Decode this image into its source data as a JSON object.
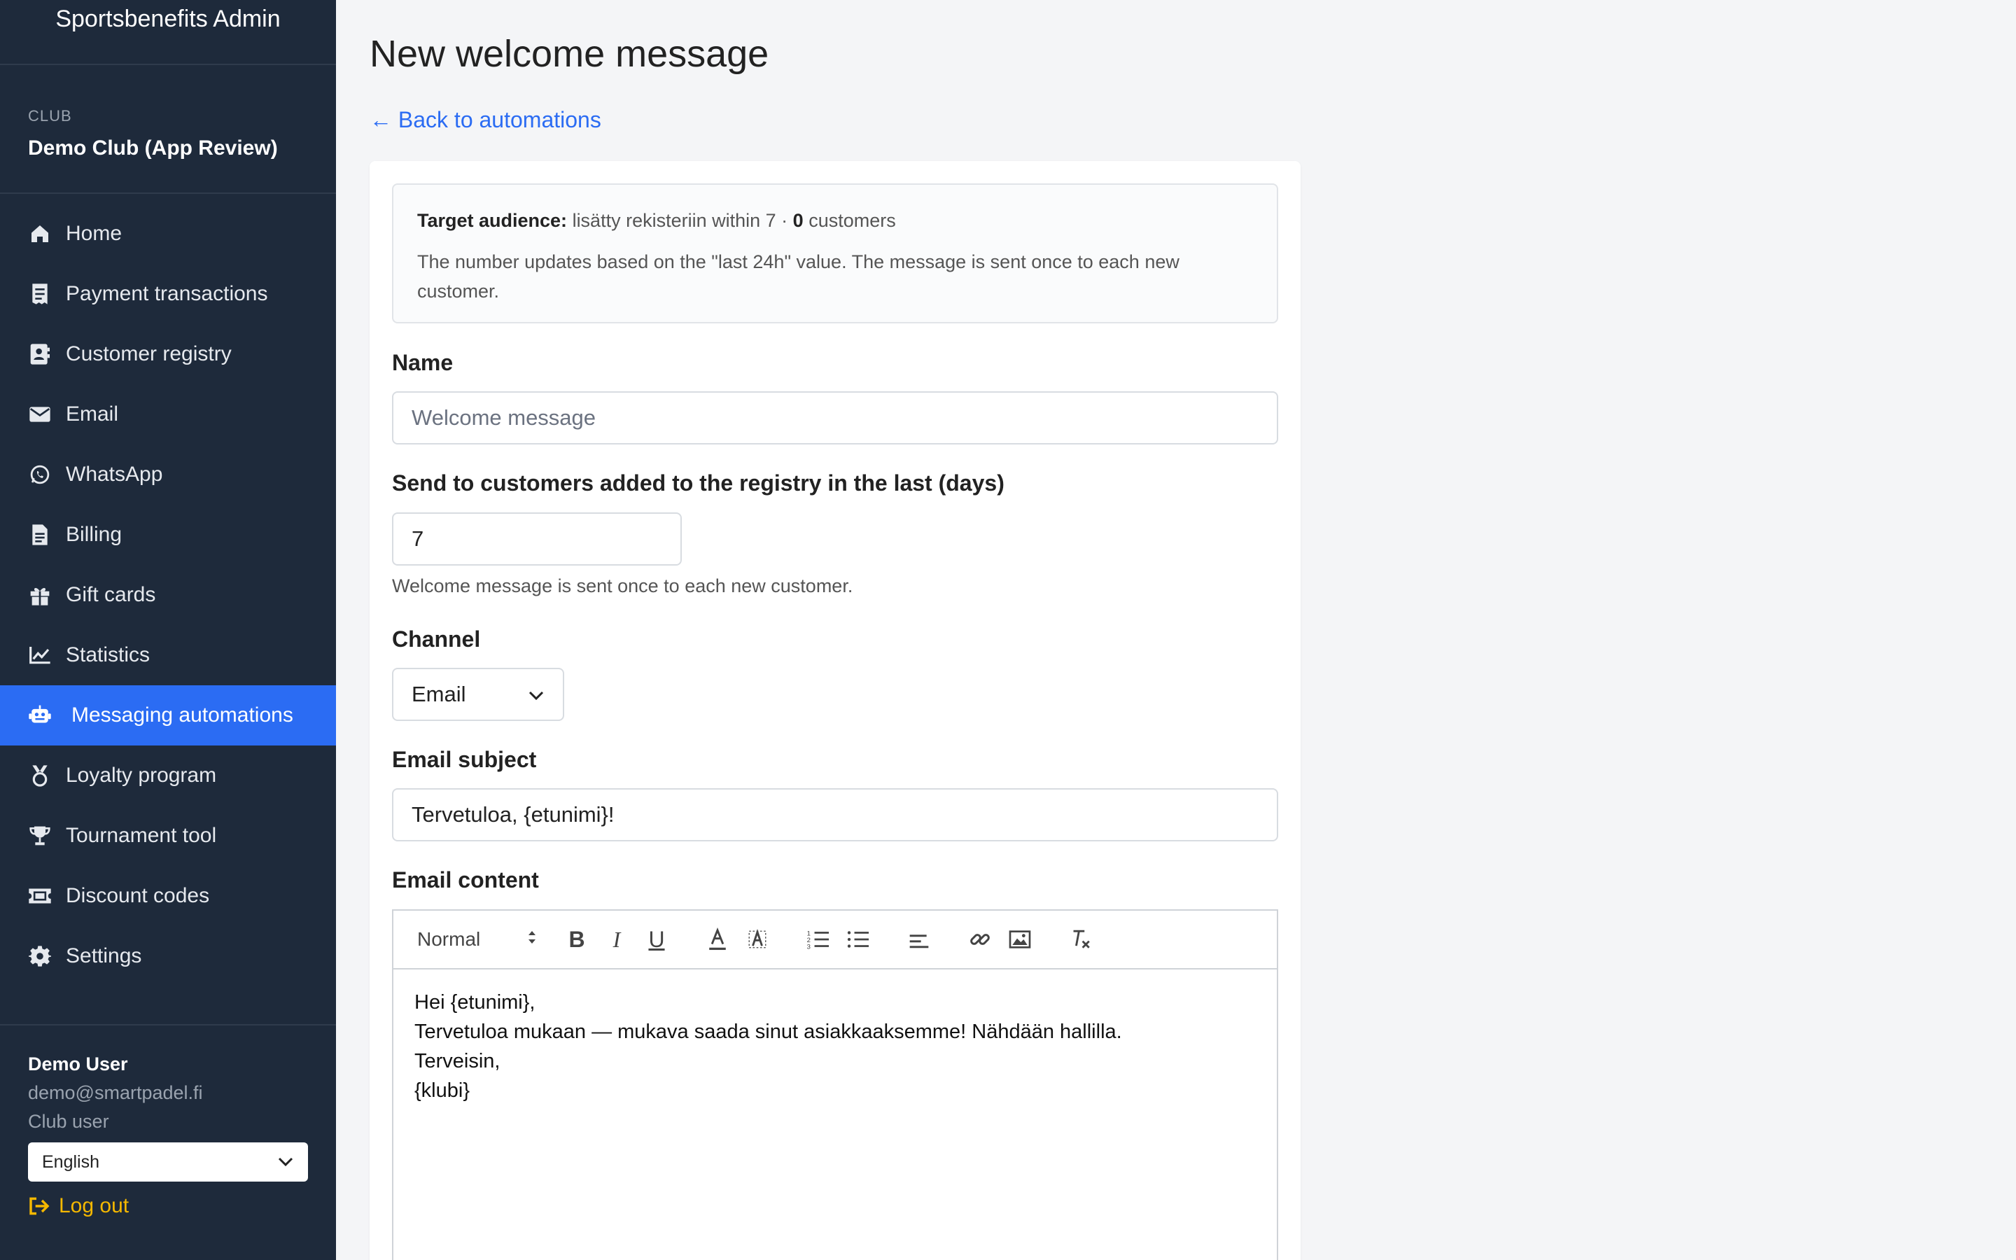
{
  "app": {
    "title": "Sportsbenefits Admin"
  },
  "club": {
    "caption": "CLUB",
    "name": "Demo Club (App Review)"
  },
  "nav": {
    "items": [
      {
        "label": "Home",
        "icon": "home-icon"
      },
      {
        "label": "Payment transactions",
        "icon": "receipt-icon"
      },
      {
        "label": "Customer registry",
        "icon": "contact-card-icon"
      },
      {
        "label": "Email",
        "icon": "envelope-icon"
      },
      {
        "label": "WhatsApp",
        "icon": "whatsapp-icon"
      },
      {
        "label": "Billing",
        "icon": "invoice-icon"
      },
      {
        "label": "Gift cards",
        "icon": "gift-icon"
      },
      {
        "label": "Statistics",
        "icon": "chart-line-icon"
      },
      {
        "label": "Messaging automations",
        "icon": "robot-icon",
        "active": true
      },
      {
        "label": "Loyalty program",
        "icon": "medal-icon"
      },
      {
        "label": "Tournament tool",
        "icon": "trophy-icon"
      },
      {
        "label": "Discount codes",
        "icon": "ticket-icon"
      },
      {
        "label": "Settings",
        "icon": "gear-icon"
      }
    ]
  },
  "user": {
    "name": "Demo User",
    "email": "demo@smartpadel.fi",
    "role": "Club user",
    "language": "English",
    "logout_label": "Log out"
  },
  "page": {
    "title": "New welcome message",
    "back_link": "← Back to automations"
  },
  "audience": {
    "label": "Target audience:",
    "text": " lisätty rekisteriin within 7 · ",
    "count": "0",
    "unit": " customers",
    "note": "The number updates based on the \"last 24h\" value. The message is sent once to each new customer."
  },
  "form": {
    "name_label": "Name",
    "name_placeholder": "Welcome message",
    "days_label": "Send to customers added to the registry in the last (days)",
    "days_value": "7",
    "days_help": "Welcome message is sent once to each new customer.",
    "channel_label": "Channel",
    "channel_value": "Email",
    "subject_label": "Email subject",
    "subject_value": "Tervetuloa, {etunimi}!",
    "content_label": "Email content",
    "editor_style": "Normal",
    "content_lines": [
      "Hei {etunimi},",
      "Tervetuloa mukaan — mukava saada sinut asiakkaaksemme! Nähdään hallilla.",
      "Terveisin,",
      "{klubi}"
    ]
  },
  "colors": {
    "sidebar_bg": "#1e2a3b",
    "active_bg": "#2b6cf3",
    "link": "#2b6cf3",
    "logout": "#f5b800"
  }
}
